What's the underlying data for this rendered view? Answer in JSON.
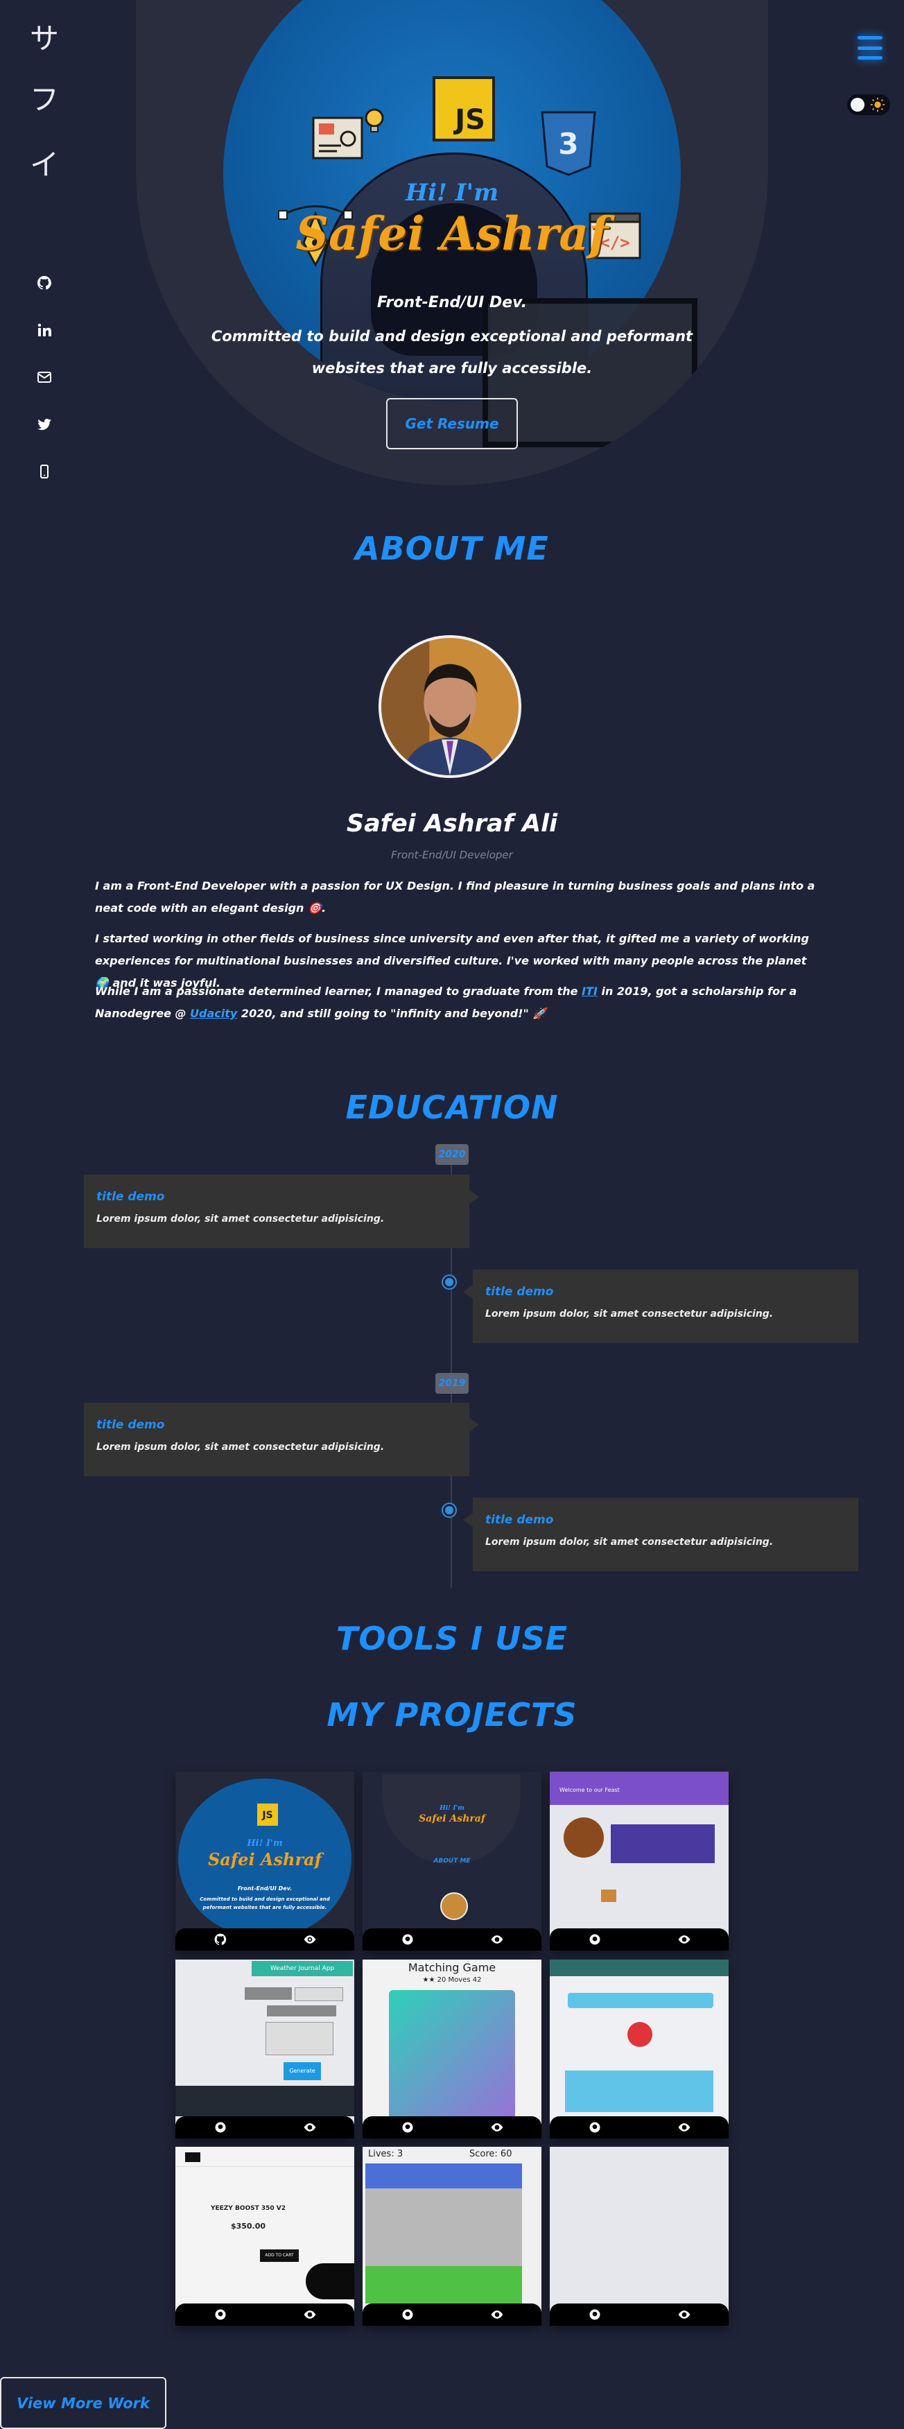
{
  "sidebar": {
    "logo": [
      "サ",
      "フ",
      "イ"
    ],
    "icons": [
      "github-icon",
      "linkedin-icon",
      "mail-icon",
      "twitter-icon",
      "phone-icon"
    ]
  },
  "header": {
    "menu_icon": "hamburger-icon",
    "theme_toggle_icon": "sun-icon"
  },
  "hero": {
    "greeting": "Hi! I'm",
    "name": "Safei Ashraf",
    "role": "Front-End/UI Dev.",
    "tagline": "Committed to build and design exceptional and peformant websites that are fully accessible.",
    "resume_button": "Get Resume",
    "js_badge": "JS"
  },
  "about": {
    "title": "ABOUT ME",
    "name": "Safei Ashraf Ali",
    "role": "Front-End/UI Developer",
    "p1": "I am a Front-End Developer with a passion for UX Design. I find pleasure in turning business goals and plans into a neat code with an elegant design 🎯.",
    "p2": "I started working in other fields of business since university and even after that, it gifted me a variety of working experiences for multinational businesses and diversified culture. I've worked with many people across the planet 🌍 and it was joyful.",
    "p3_a": "While I am a passionate determined learner, I managed to graduate from the ",
    "p3_iti": "ITI",
    "p3_b": " in 2019, got a scholarship for a Nanodegree @ ",
    "p3_udacity": "Udacity",
    "p3_c": " 2020, and still going to \"infinity and beyond!\" 🚀"
  },
  "education": {
    "title": "EDUCATION",
    "years": [
      "2020",
      "2019"
    ],
    "items": [
      {
        "title": "title demo",
        "desc": "Lorem ipsum dolor, sit amet consectetur adipisicing."
      },
      {
        "title": "title demo",
        "desc": "Lorem ipsum dolor, sit amet consectetur adipisicing."
      },
      {
        "title": "title demo",
        "desc": "Lorem ipsum dolor, sit amet consectetur adipisicing."
      },
      {
        "title": "title demo",
        "desc": "Lorem ipsum dolor, sit amet consectetur adipisicing."
      }
    ]
  },
  "tools": {
    "title": "TOOLS I USE"
  },
  "projects": {
    "title": "MY PROJECTS",
    "cards": [
      {
        "name": "portfolio-hero"
      },
      {
        "name": "portfolio-mobile"
      },
      {
        "name": "restaurant-site",
        "heading": "Welcome to our Feast"
      },
      {
        "name": "weather-journal",
        "heading": "Weather Journal App",
        "button": "Generate"
      },
      {
        "name": "matching-game",
        "heading": "Matching Game",
        "stats": "★★ 20 Moves 42"
      },
      {
        "name": "arabic-app"
      },
      {
        "name": "shoe-store",
        "product": "YEEZY BOOST 350 V2",
        "price": "$350.00",
        "cart": "ADD TO CART"
      },
      {
        "name": "frogger-game",
        "lives": "Lives: 3",
        "score": "Score: 60"
      },
      {
        "name": "empty-project"
      }
    ],
    "button_icons": [
      "github-icon",
      "eye-icon"
    ],
    "view_more": "View More Work"
  },
  "colors": {
    "accent": "#1e90ff",
    "name_orange": "#f2a21c",
    "bg": "#1f2337",
    "card": "#333333"
  }
}
